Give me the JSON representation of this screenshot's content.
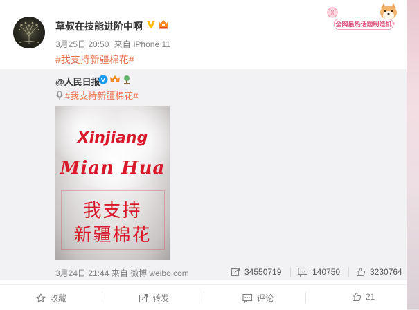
{
  "post": {
    "username": "草叔在技能进阶中啊",
    "date": "3月25日 20:50",
    "via_prefix": "来自",
    "device": "iPhone 11",
    "hashtag": "#我支持新疆棉花#"
  },
  "promo": {
    "label": "全网最热话题制造机"
  },
  "repost": {
    "username": "@人民日报",
    "hashtag": "#我支持新疆棉花#",
    "image_text": {
      "line1": "Xinjiang",
      "line2": "Mian Hua",
      "line3": "我支持",
      "line4": "新疆棉花"
    },
    "date": "3月24日 21:44",
    "via_prefix": "来自",
    "source": "微博 weibo.com",
    "stats": {
      "reposts": "34550719",
      "comments": "140750",
      "likes": "3230764"
    }
  },
  "actions": {
    "favorite": "收藏",
    "forward": "转发",
    "comment": "评论",
    "like": "21"
  },
  "colors": {
    "link": "#eb7350",
    "meta": "#808080",
    "verified": "#ffc000",
    "image_text": "#d7192a"
  }
}
